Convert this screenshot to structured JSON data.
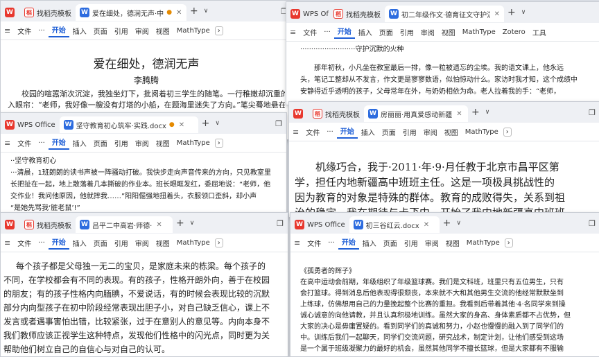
{
  "ribbon": {
    "file": "文件",
    "more": "···",
    "start": "开始",
    "insert": "插入",
    "page": "页面",
    "ref": "引用",
    "review": "审阅",
    "view": "视图",
    "mathtype": "MathType",
    "zotero": "Zotero",
    "tools": "工具"
  },
  "tabs": {
    "wps": "WPS Office",
    "wps_short": "WPS Of",
    "template": "找稻壳模板"
  },
  "w1": {
    "doc_tab": "爱在细处，德润无声·中",
    "title": "爱在细处，德润无声",
    "author": "李腾腾",
    "lines": [
      "校园的喧嚣渐次沉淀，我独坐灯下，批阅着初三学生的随笔。一行稚嫩却沉重的字迹",
      "入眼帘：“老师，我好像一艘没有灯塔的小船，在题海里迷失了方向。”笔尖蓦地悬在半空"
    ]
  },
  "w2": {
    "doc_tab": "坚守教育初心筑牢·实践.docx",
    "lines": [
      "··坚守教育初心",
      "···清晨，1班朗朗的读书声被一阵骚动打破。我快步走向声音传来的方向，只见教室里",
      "长把扯在一起，地上散落着几本撕破的作业本。班长眼眶发红，委屈地说：“老师，他",
      "交作业！我问他原因，他就摔我……”阳阳倔强地扭着头，衣服领口歪斜，却小声",
      "“是她先骂我‘脏老鼠’!”"
    ]
  },
  "w3": {
    "doc_tab": "初二年级作文·德育征文守护沉默",
    "lines": [
      "·························守护沉默的火种",
      "那年初秋，小凡坐在教室最后一排，像一粒被遗忘的尘埃。我的语文课上，他永远",
      "头，笔记工整却从不发言，作文更是寥寥数语，似怕惊动什么。家访时我才知，这个成绩中",
      "安静得近乎透明的孩子，父母常年在外，与奶奶相依为命。老人拉着我的手：“老师，"
    ]
  },
  "w4": {
    "doc_tab": "房丽丽·用真爱感动新疆",
    "lines": [
      "机缘巧合，我于·2011·年·9·月任教于北京市昌平区第",
      "学，担任内地新疆高中班班主任。这是一项极具挑战性的",
      "因为教育的对象是特殊的群体。教育的成败得失，关系到祖",
      "治的稳定，我在期待与忐忑中，开始了我内地新疆高中班班"
    ]
  },
  "w5": {
    "doc_tab": "吕平二中高岩·师德·",
    "lines": [
      "每个孩子都是父母独一无二的宝贝，是家庭未来的栋梁。每个孩子的",
      "不同，在学校都会有不同的表现。有的孩子，性格开朗外向，善于在校园",
      "的朋友；有的孩子性格内向腼腆，不爱说话，有的时候会表现比较的沉默",
      "部分内向型孩子在初中阶段经常表现出胆子小，对自己缺乏信心，课上不",
      "发言或者遇事害怕出错，比较紧张，过于在意别人的意见等。内向本身不",
      "我们教师应该正视学生这种特点，发现他们性格中的闪光点，同时更为关",
      "帮助他们树立自己的自信心与对自己的认可。"
    ]
  },
  "w6": {
    "doc_tab": "初三谷红云.docx",
    "lines": [
      "《孤勇者的辉子》",
      "在高中运动会前期，年级组织了年级篮球赛。我们是文科班，班里只有五位男生，只有",
      "会打篮球。得到消息后他表现得很颓丧，本来就不大和其他男生交流的他经常默默坐到",
      "上练球，仿佛想用自己的力量挽起整个比赛的重担。我看到后带着其他·4·名同学来到操",
      "诚心诚意的向他请教，并且认真积极地训练。虽然大家的身高、身体素质都不占优势，但",
      "大家的决心是毋庸置疑的。看到同学们的真诚和努力，小赵也慢慢的融入到了同学们的",
      "中。训练后我们一起聊天，同学们交流问题，研究战术，制定计划，让他们感受到这场",
      "是一个属于班级凝聚力的最好的机会，虽然其他同学不擅长篮球，但是大家都有不服输"
    ]
  }
}
